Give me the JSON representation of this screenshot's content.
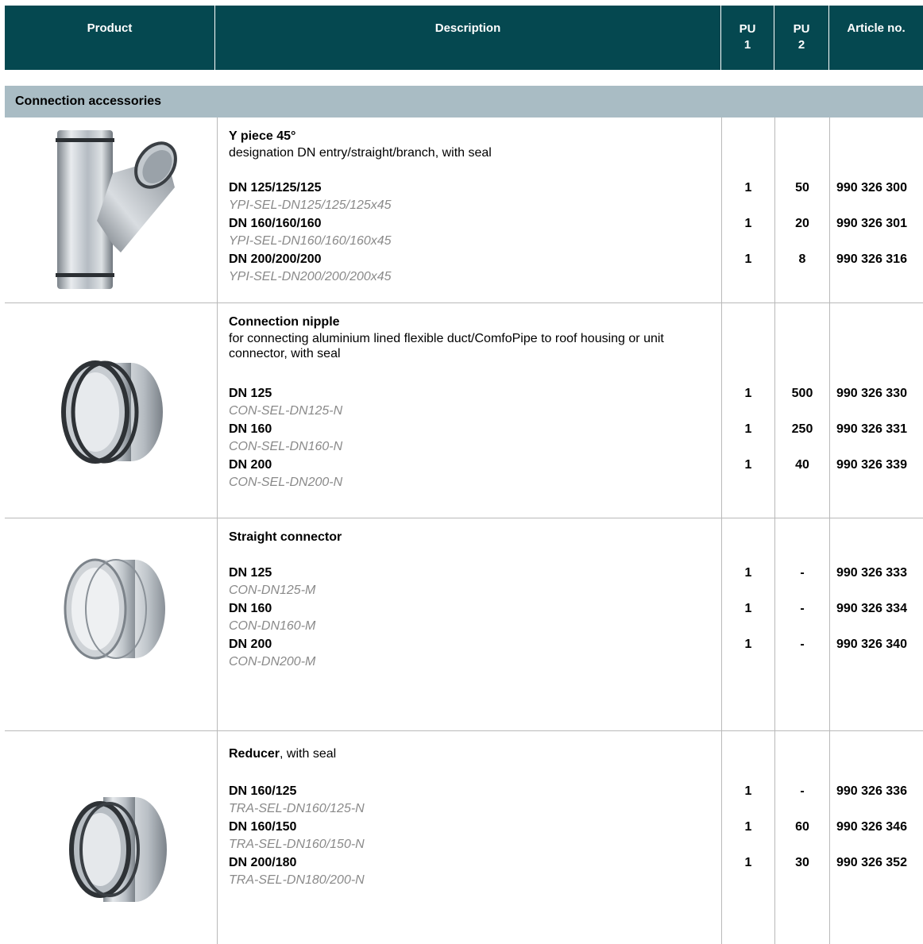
{
  "header": {
    "product": "Product",
    "description": "Description",
    "pu1_line1": "PU",
    "pu1_line2": "1",
    "pu2_line1": "PU",
    "pu2_line2": "2",
    "article": "Article no."
  },
  "section_title": "Connection accessories",
  "products": [
    {
      "title": "Y piece 45°",
      "description": "designation DN entry/straight/branch, with seal",
      "variants": [
        {
          "size": "DN 125/125/125",
          "code": "YPI-SEL-DN125/125/125x45",
          "pu1": "1",
          "pu2": "50",
          "article": "990 326 300"
        },
        {
          "size": "DN 160/160/160",
          "code": "YPI-SEL-DN160/160/160x45",
          "pu1": "1",
          "pu2": "20",
          "article": "990 326 301"
        },
        {
          "size": "DN 200/200/200",
          "code": "YPI-SEL-DN200/200/200x45",
          "pu1": "1",
          "pu2": "8",
          "article": "990 326 316"
        }
      ]
    },
    {
      "title": "Connection nipple",
      "description": "for connecting aluminium lined flexible duct/ComfoPipe to roof housing or unit connector, with seal",
      "variants": [
        {
          "size": "DN 125",
          "code": "CON-SEL-DN125-N",
          "pu1": "1",
          "pu2": "500",
          "article": "990 326 330"
        },
        {
          "size": "DN 160",
          "code": "CON-SEL-DN160-N",
          "pu1": "1",
          "pu2": "250",
          "article": "990 326 331"
        },
        {
          "size": "DN 200",
          "code": "CON-SEL-DN200-N",
          "pu1": "1",
          "pu2": "40",
          "article": "990 326 339"
        }
      ]
    },
    {
      "title": "Straight connector",
      "description": "",
      "variants": [
        {
          "size": "DN 125",
          "code": "CON-DN125-M",
          "pu1": "1",
          "pu2": "-",
          "article": "990 326 333"
        },
        {
          "size": "DN 160",
          "code": "CON-DN160-M",
          "pu1": "1",
          "pu2": "-",
          "article": "990 326 334"
        },
        {
          "size": "DN 200",
          "code": "CON-DN200-M",
          "pu1": "1",
          "pu2": "-",
          "article": "990 326 340"
        }
      ]
    },
    {
      "title": "Reducer",
      "title_suffix": ", with seal",
      "description": "",
      "variants": [
        {
          "size": "DN 160/125",
          "code": "TRA-SEL-DN160/125-N",
          "pu1": "1",
          "pu2": "-",
          "article": "990 326 336"
        },
        {
          "size": "DN 160/150",
          "code": "TRA-SEL-DN160/150-N",
          "pu1": "1",
          "pu2": "60",
          "article": "990 326 346"
        },
        {
          "size": "DN 200/180",
          "code": "TRA-SEL-DN180/200-N",
          "pu1": "1",
          "pu2": "30",
          "article": "990 326 352"
        }
      ]
    }
  ]
}
